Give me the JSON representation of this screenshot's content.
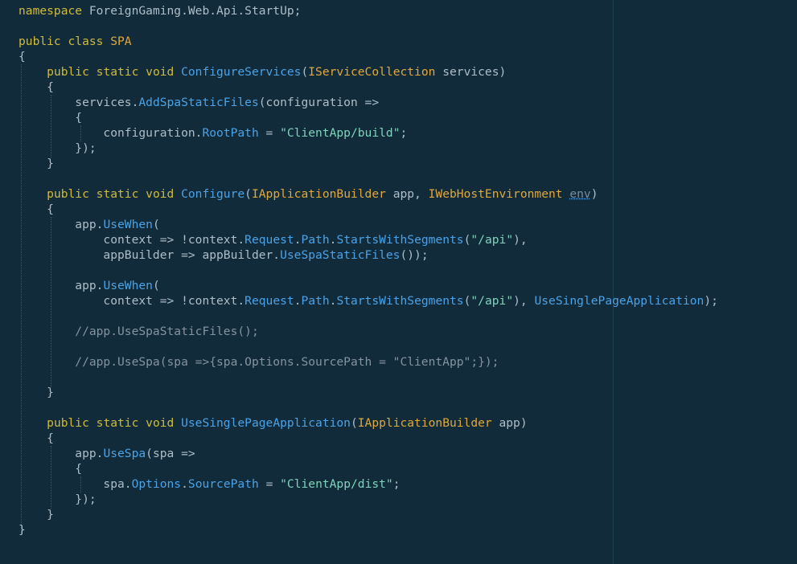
{
  "editor": {
    "theme_colors": {
      "background": "#112b3a",
      "keyword": "#d0bb3a",
      "type": "#e0a83a",
      "method": "#4aa3e8",
      "string": "#7fd3bc",
      "comment": "#8593a0",
      "text": "#aebec8"
    },
    "lines": [
      [
        [
          "kw",
          "namespace"
        ],
        [
          "id",
          " ForeignGaming.Web.Api.StartUp;"
        ]
      ],
      [],
      [
        [
          "kw",
          "public class "
        ],
        [
          "ty",
          "SPA"
        ]
      ],
      [
        [
          "id",
          "{"
        ]
      ],
      [
        [
          "id",
          "    "
        ],
        [
          "kw",
          "public static void "
        ],
        [
          "fn",
          "ConfigureServices"
        ],
        [
          "id",
          "("
        ],
        [
          "ty",
          "IServiceCollection"
        ],
        [
          "id",
          " services)"
        ]
      ],
      [
        [
          "id",
          "    {"
        ]
      ],
      [
        [
          "id",
          "        services."
        ],
        [
          "fn",
          "AddSpaStaticFiles"
        ],
        [
          "id",
          "(configuration =>"
        ]
      ],
      [
        [
          "id",
          "        {"
        ]
      ],
      [
        [
          "id",
          "            configuration."
        ],
        [
          "fn",
          "RootPath"
        ],
        [
          "id",
          " = "
        ],
        [
          "str",
          "\"ClientApp/build\""
        ],
        [
          "id",
          ";"
        ]
      ],
      [
        [
          "id",
          "        });"
        ]
      ],
      [
        [
          "id",
          "    }"
        ]
      ],
      [],
      [
        [
          "id",
          "    "
        ],
        [
          "kw",
          "public static void "
        ],
        [
          "fn",
          "Configure"
        ],
        [
          "id",
          "("
        ],
        [
          "ty",
          "IApplicationBuilder"
        ],
        [
          "id",
          " app, "
        ],
        [
          "ty",
          "IWebHostEnvironment"
        ],
        [
          "id",
          " "
        ],
        [
          "dim",
          "env"
        ],
        [
          "id",
          ")"
        ]
      ],
      [
        [
          "id",
          "    {"
        ]
      ],
      [
        [
          "id",
          "        app."
        ],
        [
          "fn",
          "UseWhen"
        ],
        [
          "id",
          "("
        ]
      ],
      [
        [
          "id",
          "            context => !context."
        ],
        [
          "fn",
          "Request"
        ],
        [
          "id",
          "."
        ],
        [
          "fn",
          "Path"
        ],
        [
          "id",
          "."
        ],
        [
          "fn",
          "StartsWithSegments"
        ],
        [
          "id",
          "("
        ],
        [
          "str",
          "\"/api\""
        ],
        [
          "id",
          "),"
        ]
      ],
      [
        [
          "id",
          "            appBuilder => appBuilder."
        ],
        [
          "fn",
          "UseSpaStaticFiles"
        ],
        [
          "id",
          "());"
        ]
      ],
      [],
      [
        [
          "id",
          "        app."
        ],
        [
          "fn",
          "UseWhen"
        ],
        [
          "id",
          "("
        ]
      ],
      [
        [
          "id",
          "            context => !context."
        ],
        [
          "fn",
          "Request"
        ],
        [
          "id",
          "."
        ],
        [
          "fn",
          "Path"
        ],
        [
          "id",
          "."
        ],
        [
          "fn",
          "StartsWithSegments"
        ],
        [
          "id",
          "("
        ],
        [
          "str",
          "\"/api\""
        ],
        [
          "id",
          "), "
        ],
        [
          "fn",
          "UseSinglePageApplication"
        ],
        [
          "id",
          ");"
        ]
      ],
      [],
      [
        [
          "cm",
          "        //app.UseSpaStaticFiles();"
        ]
      ],
      [],
      [
        [
          "cm",
          "        //app.UseSpa(spa =>{spa.Options.SourcePath = \"ClientApp\";});"
        ]
      ],
      [],
      [
        [
          "id",
          "    }"
        ]
      ],
      [],
      [
        [
          "id",
          "    "
        ],
        [
          "kw",
          "public static void "
        ],
        [
          "fn",
          "UseSinglePageApplication"
        ],
        [
          "id",
          "("
        ],
        [
          "ty",
          "IApplicationBuilder"
        ],
        [
          "id",
          " app)"
        ]
      ],
      [
        [
          "id",
          "    {"
        ]
      ],
      [
        [
          "id",
          "        app."
        ],
        [
          "fn",
          "UseSpa"
        ],
        [
          "id",
          "(spa =>"
        ]
      ],
      [
        [
          "id",
          "        {"
        ]
      ],
      [
        [
          "id",
          "            spa."
        ],
        [
          "fn",
          "Options"
        ],
        [
          "id",
          "."
        ],
        [
          "fn",
          "SourcePath"
        ],
        [
          "id",
          " = "
        ],
        [
          "str",
          "\"ClientApp/dist\""
        ],
        [
          "id",
          ";"
        ]
      ],
      [
        [
          "id",
          "        });"
        ]
      ],
      [
        [
          "id",
          "    }"
        ]
      ],
      [
        [
          "id",
          "}"
        ]
      ]
    ]
  }
}
